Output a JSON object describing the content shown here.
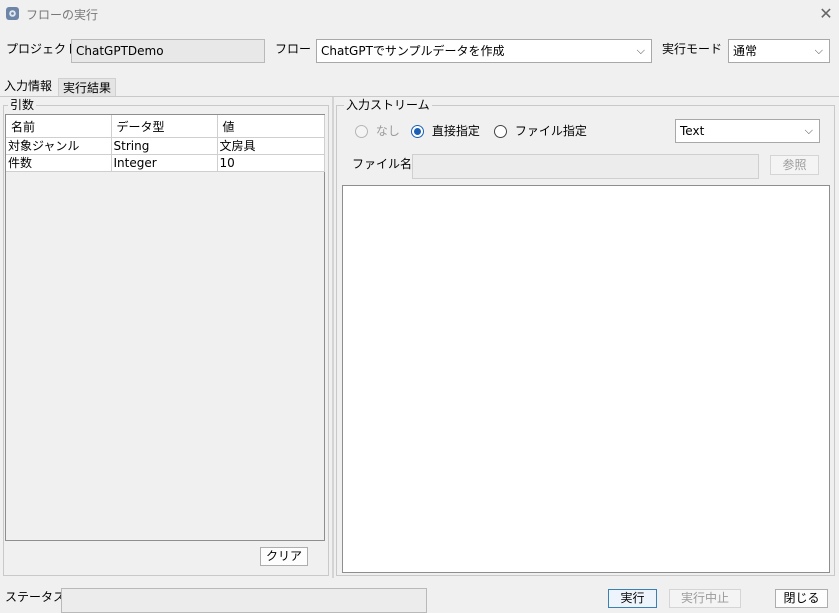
{
  "window": {
    "title": "フローの実行",
    "close": "✕"
  },
  "header": {
    "project_label": "プロジェクト",
    "project_value": "ChatGPTDemo",
    "flow_label": "フロー",
    "flow_value": "ChatGPTでサンプルデータを作成",
    "mode_label": "実行モード",
    "mode_value": "通常"
  },
  "tabs": [
    {
      "label": "入力情報",
      "active": true
    },
    {
      "label": "実行結果",
      "active": false
    }
  ],
  "args": {
    "title": "引数",
    "columns": [
      "名前",
      "データ型",
      "値"
    ],
    "rows": [
      [
        "対象ジャンル",
        "String",
        "文房具"
      ],
      [
        "件数",
        "Integer",
        "10"
      ]
    ],
    "clear_label": "クリア"
  },
  "stream": {
    "title": "入力ストリーム",
    "radio_none": "なし",
    "radio_direct": "直接指定",
    "radio_file": "ファイル指定",
    "selected": "直接指定",
    "type_value": "Text",
    "file_label": "ファイル名",
    "file_value": "",
    "browse_label": "参照",
    "content": ""
  },
  "footer": {
    "status_label": "ステータス",
    "status_value": "",
    "run_label": "実行",
    "stop_label": "実行中止",
    "close_label": "閉じる"
  },
  "icons": {
    "chevron": "⌵",
    "app": "gear-app-icon"
  },
  "colors": {
    "accent": "#1a5fb4",
    "disabled_text": "#9a9a9a"
  }
}
